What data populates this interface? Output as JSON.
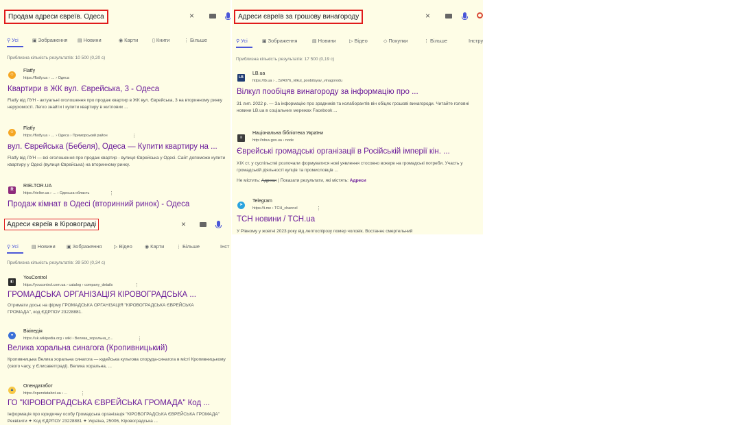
{
  "panel1": {
    "query": "Продам адреси євреїв. Одеса",
    "tabs": [
      "Усі",
      "Зображення",
      "Новини",
      "Карти",
      "Книги",
      "Більше"
    ],
    "stats": "Приблизна кількість результатів: 10 500 (0,20 с)",
    "results": [
      {
        "site": "Flatfy",
        "url": "https://flatfy.ua › … › Одеса",
        "title": "Квартири в ЖК вул. Єврейська, 3 - Одеса",
        "snippet": "Flatfy від ЛУН - актуальні оголошення про продаж квартир в ЖК вул. Єврейська, 3 на вторинному ринку нерухомості. Легко знайти і купити квартиру в житлових ..."
      },
      {
        "site": "Flatfy",
        "url": "https://flatfy.ua › … › Одеса › Приморський район",
        "title": "вул. Єврейська (Бебеля), Одеса — Купити квартиру на ...",
        "snippet": "Flatfy від ЛУН — всі оголошення про продаж квартир - вулиця Єврейська у Одесі. Сайт допоможе купити квартиру у Одесі (вулиця Єврейська) на вторинному ринку."
      },
      {
        "site": "RIELTOR.UA",
        "url": "https://rieltor.ua › … › Одеська область",
        "title": "Продаж кімнат в Одесі (вторинний ринок) - Одеса",
        "snippet": ""
      }
    ]
  },
  "panel2": {
    "query": "Адреси євреїв за грошову винагороду",
    "tabs": [
      "Усі",
      "Зображення",
      "Новини",
      "Відео",
      "Покупки",
      "Більше",
      "Інстру"
    ],
    "stats": "Приблизна кількість результатів: 17 500 (0,19 с)",
    "results": [
      {
        "site": "LB.ua",
        "url": "https://lb.ua › ...524076_vilkul_poobitsyav_vinagorodu",
        "title": "Вілкул пообіцяв винагороду за інформацію про ...",
        "snippet": "31 лип. 2022 р. — За інформацію про зрадників та колаборантів він обіцяє грошові винагороди. Читайте головні новини LB.ua в соціальних мережах Facebook ..."
      },
      {
        "site": "Національна бібліотека України",
        "url": "http://nbuv.gov.ua › node",
        "title": "Єврейські громадські організації в Російській імперії кін. ...",
        "snippet": "XIX ст. у суспільстві розпочали формуватися нові уявлення стосовно вокерв на громадські потреби. Участь у громадській діяльності купців та промисловців ...",
        "missing_label": "Не містить:",
        "missing_word": "Адреси",
        "missing_sep": "|",
        "show_label": "Показати результати, які містять:",
        "show_word": "Адреси"
      },
      {
        "site": "Telegram",
        "url": "https://t.me › TCH_channel",
        "title": "ТСН новини / TCH.ua",
        "snippet": "У Рівному у жовтні 2023 року від лептоспірозу помер чоловік. Востаннє смертельний"
      }
    ]
  },
  "panel3": {
    "query": "Адреси євреїв в Кіровограді",
    "tabs": [
      "Усі",
      "Новини",
      "Зображення",
      "Відео",
      "Карти",
      "Більше",
      "Інст"
    ],
    "stats": "Приблизна кількість результатів: 39 500 (0,34 с)",
    "results": [
      {
        "site": "YouControl",
        "url": "https://youcontrol.com.ua › catalog › company_details",
        "title": "ГРОМАДСЬКА ОРГАНІЗАЦІЯ КІРОВОГРАДСЬКА ...",
        "snippet": "Отримати досьє на фірму ГРОМАДСЬКА ОРГАНІЗАЦІЯ \"КІРОВОГРАДСЬКА ЄВРЕЙСЬКА ГРОМАДА\", код ЄДРПОУ 23228881."
      },
      {
        "site": "Вікіпедія",
        "url": "https://uk.wikipedia.org › wiki › Велика_хоральна_с...",
        "title": "Велика хоральна синагога (Кропивницький)",
        "snippet": "Кропивницька Велика хоральна синагога — юдейська культова споруда-синагога в місті Кропивницькому (свого часу, у Єлисаветграді). Велика хоральна, ..."
      },
      {
        "site": "Опендатабот",
        "url": "https://opendatabot.ua › ...",
        "title": "ГО \"КІРОВОГРАДСЬКА ЄВРЕЙСЬКА ГРОМАДА\" Код ...",
        "snippet": "Інформація про юридичну особу Громадська організація \"КІРОВОГРАДСЬКА ЄВРЕЙСЬКА ГРОМАДА\" Реквізити ✦ Код ЄДРПОУ 23228881 ✦ Україна, 25006, Кіровоградська ..."
      }
    ]
  },
  "icons": {
    "clear": "×",
    "more": "⋮"
  },
  "colors": {
    "accent": "#4a56d8",
    "title": "#6a1b9a",
    "highlight_border": "#e01b1b",
    "panel_bg": "#fefde6"
  }
}
